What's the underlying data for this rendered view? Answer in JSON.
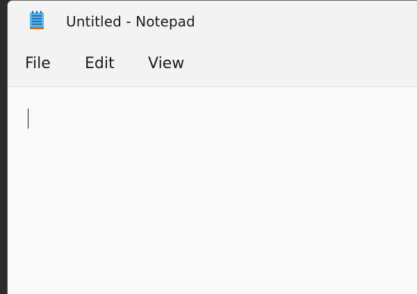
{
  "window": {
    "title": "Untitled - Notepad",
    "app_icon": "notepad-icon"
  },
  "menubar": {
    "items": [
      {
        "label": "File"
      },
      {
        "label": "Edit"
      },
      {
        "label": "View"
      }
    ]
  },
  "editor": {
    "content": ""
  },
  "colors": {
    "titlebar_bg": "#f3f3f3",
    "editor_bg": "#f9f9f9",
    "text": "#1a1a1a",
    "icon_blue": "#2f8fd6",
    "icon_orange": "#d26a1e"
  }
}
